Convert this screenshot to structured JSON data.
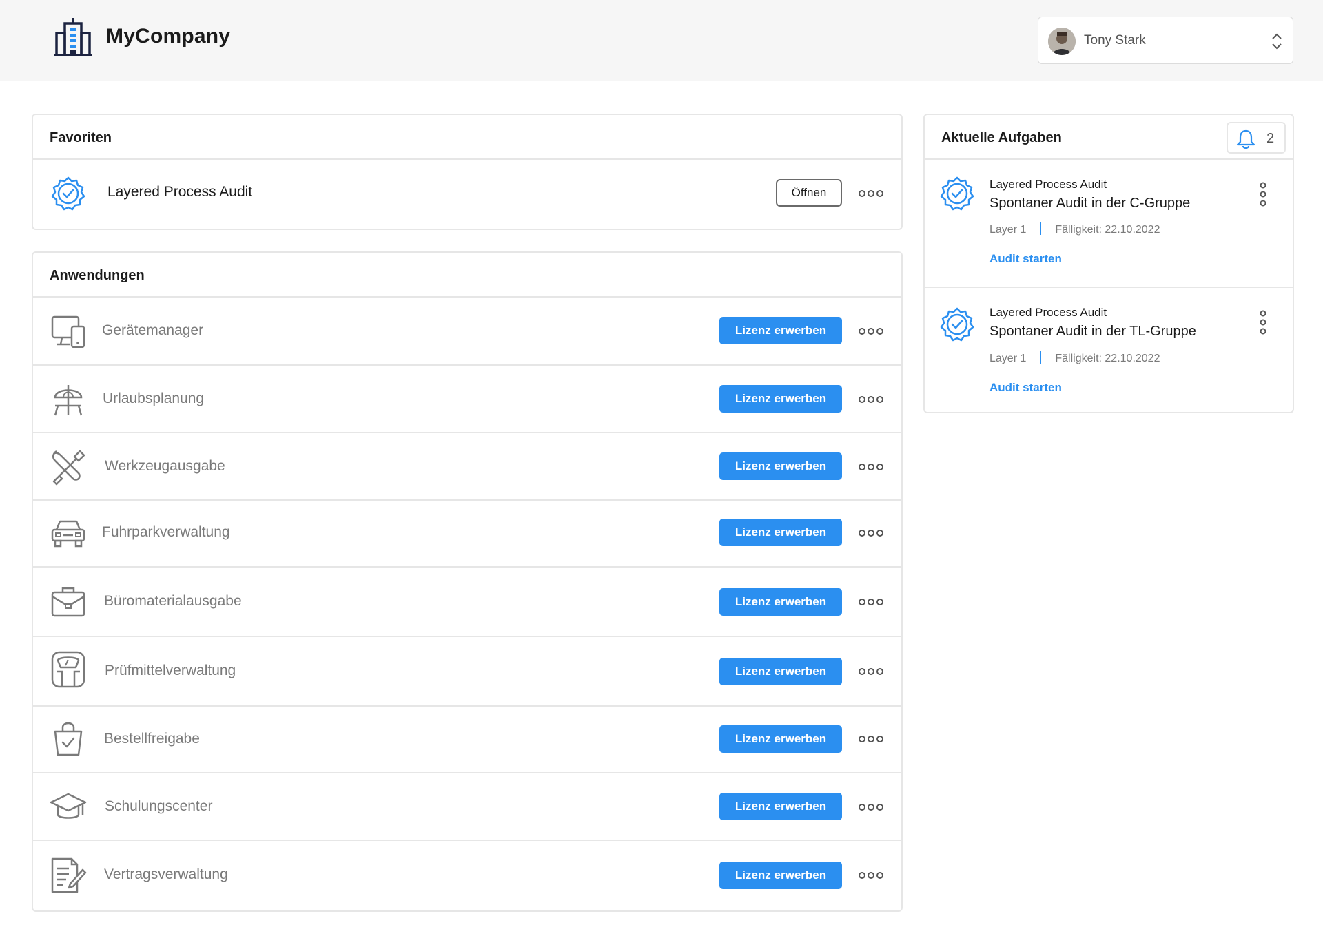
{
  "header": {
    "brand": "MyCompany",
    "user_name": "Tony Stark"
  },
  "favorites": {
    "title": "Favoriten",
    "items": [
      {
        "label": "Layered Process Audit",
        "action": "Öffnen",
        "icon": "verified-badge-icon"
      }
    ]
  },
  "applications": {
    "title": "Anwendungen",
    "items": [
      {
        "label": "Gerätemanager",
        "action": "Lizenz erwerben",
        "icon": "devices-icon"
      },
      {
        "label": "Urlaubsplanung",
        "action": "Lizenz erwerben",
        "icon": "beach-umbrella-icon"
      },
      {
        "label": "Werkzeugausgabe",
        "action": "Lizenz erwerben",
        "icon": "tools-icon"
      },
      {
        "label": "Fuhrparkverwaltung",
        "action": "Lizenz erwerben",
        "icon": "car-icon"
      },
      {
        "label": "Büromaterialausgabe",
        "action": "Lizenz erwerben",
        "icon": "briefcase-icon"
      },
      {
        "label": "Prüfmittelverwaltung",
        "action": "Lizenz erwerben",
        "icon": "scale-icon"
      },
      {
        "label": "Bestellfreigabe",
        "action": "Lizenz erwerben",
        "icon": "shopping-bag-check-icon"
      },
      {
        "label": "Schulungscenter",
        "action": "Lizenz erwerben",
        "icon": "graduation-cap-icon"
      },
      {
        "label": "Vertragsverwaltung",
        "action": "Lizenz erwerben",
        "icon": "contract-icon"
      }
    ]
  },
  "tasks": {
    "title": "Aktuelle Aufgaben",
    "notification_count": "2",
    "items": [
      {
        "app": "Layered Process Audit",
        "title": "Spontaner Audit in der C-Gruppe",
        "layer": "Layer 1",
        "due": "Fälligkeit: 22.10.2022",
        "action": "Audit starten"
      },
      {
        "app": "Layered Process Audit",
        "title": "Spontaner Audit in der TL-Gruppe",
        "layer": "Layer 1",
        "due": "Fälligkeit: 22.10.2022",
        "action": "Audit starten"
      }
    ]
  },
  "colors": {
    "accent": "#2b8ff0",
    "logo": "#1c2340",
    "muted_text": "#7a7a7a",
    "border": "#e6e6e6"
  }
}
